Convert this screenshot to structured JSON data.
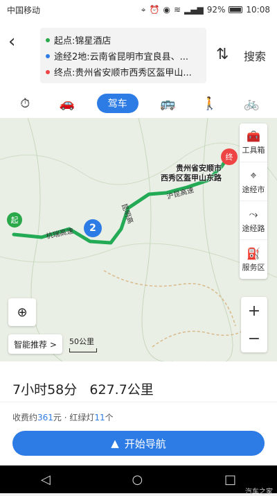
{
  "status": {
    "carrier": "中国移动",
    "battery": "92%",
    "time": "10:08"
  },
  "header": {
    "start": "起点:锦星酒店",
    "via": "途经2地:云南省昆明市宜良县、...",
    "end": "终点:贵州省安顺市西秀区盔甲山...",
    "search_label": "搜索"
  },
  "modes": [
    {
      "icon": "taxi-icon",
      "label": "⏱"
    },
    {
      "icon": "rideshare-icon",
      "label": "🚗"
    },
    {
      "icon": "drive-tab",
      "label": "驾车"
    },
    {
      "icon": "bus-icon",
      "label": "🚌"
    },
    {
      "icon": "walk-icon",
      "label": "🚶"
    },
    {
      "icon": "bike-icon",
      "label": "🚲"
    }
  ],
  "map": {
    "tools": [
      {
        "label": "工具箱",
        "icon": "toolbox-icon"
      },
      {
        "label": "途经市",
        "icon": "pin-icon"
      },
      {
        "label": "途经路",
        "icon": "route-icon"
      },
      {
        "label": "服务区",
        "icon": "service-icon"
      }
    ],
    "smart_label": "智能推荐 >",
    "scale_label": "50公里",
    "dest_label_line1": "贵州省安顺市",
    "dest_label_line2": "西秀区盔甲山东路",
    "start_pin": "起",
    "end_pin": "终",
    "via_pin": "2",
    "road_labels": [
      "杭瑞高速",
      "昆明高",
      "沪昆高速"
    ]
  },
  "summary": {
    "time": "7小时58分",
    "distance": "627.7公里"
  },
  "fee": {
    "prefix": "收费约",
    "amount": "361",
    "unit": "元 · 红绿灯",
    "lights": "11",
    "suffix": "个"
  },
  "nav_button": "开始导航",
  "watermark": "汽车之家"
}
